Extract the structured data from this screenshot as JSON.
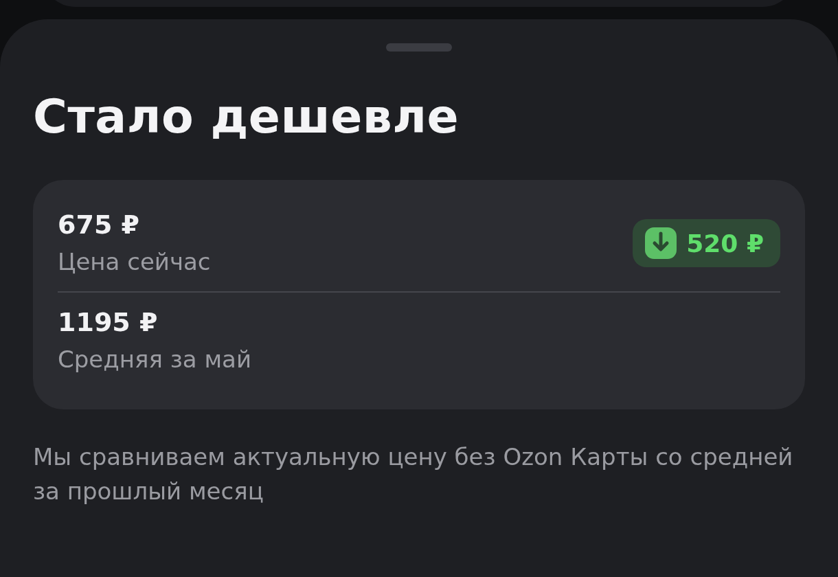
{
  "sheet": {
    "title": "Стало дешевле",
    "prices": [
      {
        "value": "675 ₽",
        "label": "Цена сейчас",
        "badge": "520 ₽"
      },
      {
        "value": "1195 ₽",
        "label": "Средняя за май"
      }
    ],
    "note": "Мы сравниваем актуальную цену без Ozon Карты со средней за прошлый месяц"
  }
}
